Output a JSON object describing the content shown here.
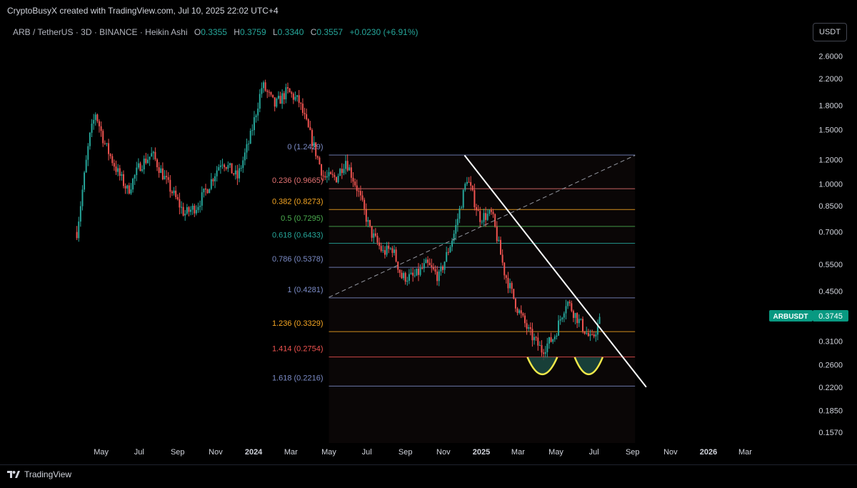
{
  "header": {
    "credit": "CryptoBusyX created with TradingView.com, Jul 10, 2025 22:02 UTC+4",
    "symbol": "ARB / TetherUS · 3D · BINANCE · Heikin Ashi",
    "ohlc": [
      {
        "label": "O",
        "value": "0.3355"
      },
      {
        "label": "H",
        "value": "0.3759"
      },
      {
        "label": "L",
        "value": "0.3340"
      },
      {
        "label": "C",
        "value": "0.3557"
      }
    ],
    "change": "+0.0230 (+6.91%)",
    "currency_button": "USDT"
  },
  "footer": {
    "brand": "TradingView"
  },
  "colors": {
    "up": "#26a69a",
    "down": "#ef5350",
    "background": "#000000",
    "text": "#b2b5be"
  },
  "chart_data": {
    "type": "candlestick",
    "scale": "log",
    "ylim": [
      0.145,
      2.9
    ],
    "price_ticks": [
      "2.6000",
      "2.2000",
      "1.8000",
      "1.5000",
      "1.2000",
      "1.0000",
      "0.8500",
      "0.7000",
      "0.5500",
      "0.4500",
      "0.3100",
      "0.2600",
      "0.2200",
      "0.1850",
      "0.1570"
    ],
    "time_ticks": [
      "May",
      "Jul",
      "Sep",
      "Nov",
      "2024",
      "Mar",
      "May",
      "Jul",
      "Sep",
      "Nov",
      "2025",
      "Mar",
      "May",
      "Jul",
      "Sep",
      "Nov",
      "2026",
      "Mar"
    ],
    "price_label": {
      "name": "ARBUSDT",
      "value": "0.3745"
    },
    "series_path": [
      [
        "2023-03-23",
        0.7
      ],
      [
        "2023-04-12",
        1.4
      ],
      [
        "2023-04-22",
        1.7
      ],
      [
        "2023-05-07",
        1.35
      ],
      [
        "2023-05-27",
        1.1
      ],
      [
        "2023-06-13",
        0.95
      ],
      [
        "2023-07-02",
        1.15
      ],
      [
        "2023-07-22",
        1.25
      ],
      [
        "2023-08-16",
        1.0
      ],
      [
        "2023-09-12",
        0.8
      ],
      [
        "2023-10-02",
        0.85
      ],
      [
        "2023-10-22",
        1.0
      ],
      [
        "2023-11-11",
        1.2
      ],
      [
        "2023-12-06",
        1.05
      ],
      [
        "2023-12-26",
        1.4
      ],
      [
        "2024-01-15",
        2.1
      ],
      [
        "2024-02-04",
        1.8
      ],
      [
        "2024-02-24",
        2.0
      ],
      [
        "2024-03-14",
        1.85
      ],
      [
        "2024-04-03",
        1.4
      ],
      [
        "2024-04-23",
        1.05
      ],
      [
        "2024-05-13",
        1.05
      ],
      [
        "2024-05-28",
        1.2
      ],
      [
        "2024-06-17",
        0.95
      ],
      [
        "2024-07-07",
        0.7
      ],
      [
        "2024-07-27",
        0.6
      ],
      [
        "2024-08-11",
        0.62
      ],
      [
        "2024-08-26",
        0.5
      ],
      [
        "2024-09-15",
        0.5
      ],
      [
        "2024-10-05",
        0.55
      ],
      [
        "2024-10-25",
        0.5
      ],
      [
        "2024-11-19",
        0.7
      ],
      [
        "2024-12-09",
        1.05
      ],
      [
        "2024-12-29",
        0.78
      ],
      [
        "2025-01-18",
        0.8
      ],
      [
        "2025-02-07",
        0.52
      ],
      [
        "2025-02-27",
        0.4
      ],
      [
        "2025-03-19",
        0.33
      ],
      [
        "2025-04-08",
        0.29
      ],
      [
        "2025-04-28",
        0.32
      ],
      [
        "2025-05-18",
        0.42
      ],
      [
        "2025-06-07",
        0.36
      ],
      [
        "2025-06-27",
        0.31
      ],
      [
        "2025-07-10",
        0.36
      ]
    ],
    "fib_levels": [
      {
        "label": "0 (1.2429)",
        "value": 1.2429,
        "color": "#7b8bc6"
      },
      {
        "label": "0.236 (0.9665)",
        "value": 0.9665,
        "color": "#e57373"
      },
      {
        "label": "0.382 (0.8273)",
        "value": 0.8273,
        "color": "#f5a623"
      },
      {
        "label": "0.5 (0.7295)",
        "value": 0.7295,
        "color": "#4caf50"
      },
      {
        "label": "0.618 (0.6433)",
        "value": 0.6433,
        "color": "#26a69a"
      },
      {
        "label": "0.786 (0.5378)",
        "value": 0.5378,
        "color": "#7b8bc6"
      },
      {
        "label": "1 (0.4281)",
        "value": 0.4281,
        "color": "#7b8bc6"
      },
      {
        "label": "1.236 (0.3329)",
        "value": 0.3329,
        "color": "#f5a623"
      },
      {
        "label": "1.414 (0.2754)",
        "value": 0.2754,
        "color": "#ef5350"
      },
      {
        "label": "1.618 (0.2216)",
        "value": 0.2216,
        "color": "#7b8bc6"
      }
    ],
    "fib_range": {
      "start": "2024-05-01",
      "end": "2025-09-05"
    },
    "trendline": {
      "start": [
        "2024-12-05",
        1.24
      ],
      "end": [
        "2025-09-23",
        0.22
      ]
    },
    "dashed_trendline": {
      "start": [
        "2024-05-01",
        0.43
      ],
      "end": [
        "2025-09-05",
        1.24
      ]
    },
    "arcs": [
      {
        "start": "2025-03-16",
        "end": "2025-05-03",
        "top": 0.275,
        "bottom": 0.242
      },
      {
        "start": "2025-05-31",
        "end": "2025-07-15",
        "top": 0.275,
        "bottom": 0.242
      }
    ]
  }
}
